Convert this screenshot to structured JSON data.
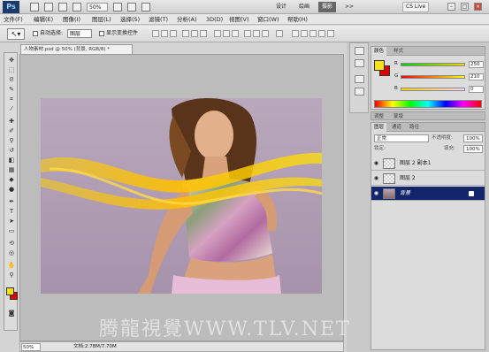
{
  "appbar": {
    "logo": "Ps",
    "zoom": "50%",
    "workspaces": [
      "设计",
      "绘画",
      "摄影"
    ],
    "active_workspace": "摄影",
    "more": ">>",
    "cs_live": "CS Live"
  },
  "menu": [
    "文件(F)",
    "编辑(E)",
    "图像(I)",
    "图层(L)",
    "选择(S)",
    "滤镜(T)",
    "分析(A)",
    "3D(D)",
    "视图(V)",
    "窗口(W)",
    "帮助(H)"
  ],
  "options": {
    "auto_select_label": "自动选择:",
    "auto_select_value": "图层",
    "show_transform_label": "显示变换控件"
  },
  "document": {
    "tab_title": "人物素材.psd @ 50% (背景, RGB/8) *",
    "zoom": "50%",
    "info": "文档:2.78M/7.70M"
  },
  "color_panel": {
    "tabs": [
      "颜色",
      "样式"
    ],
    "fg_color": "#f6e214",
    "bg_color": "#e00000",
    "channels": [
      {
        "label": "R",
        "value": "250"
      },
      {
        "label": "G",
        "value": "210"
      },
      {
        "label": "B",
        "value": "0"
      }
    ]
  },
  "adjust_tabs": [
    "调整",
    "蒙版"
  ],
  "layers_panel": {
    "tabs": [
      "图层",
      "通道",
      "路径"
    ],
    "blend_mode": "正常",
    "opacity_label": "不透明度:",
    "opacity_value": "100%",
    "lock_label": "锁定:",
    "fill_label": "填充:",
    "fill_value": "100%",
    "layers": [
      {
        "name": "图层 2 副本1",
        "selected": false,
        "type": "layer"
      },
      {
        "name": "图层 2",
        "selected": false,
        "type": "layer"
      },
      {
        "name": "背景",
        "selected": true,
        "type": "background"
      }
    ]
  },
  "watermark": "腾龍視覺WWW.TLV.NET"
}
